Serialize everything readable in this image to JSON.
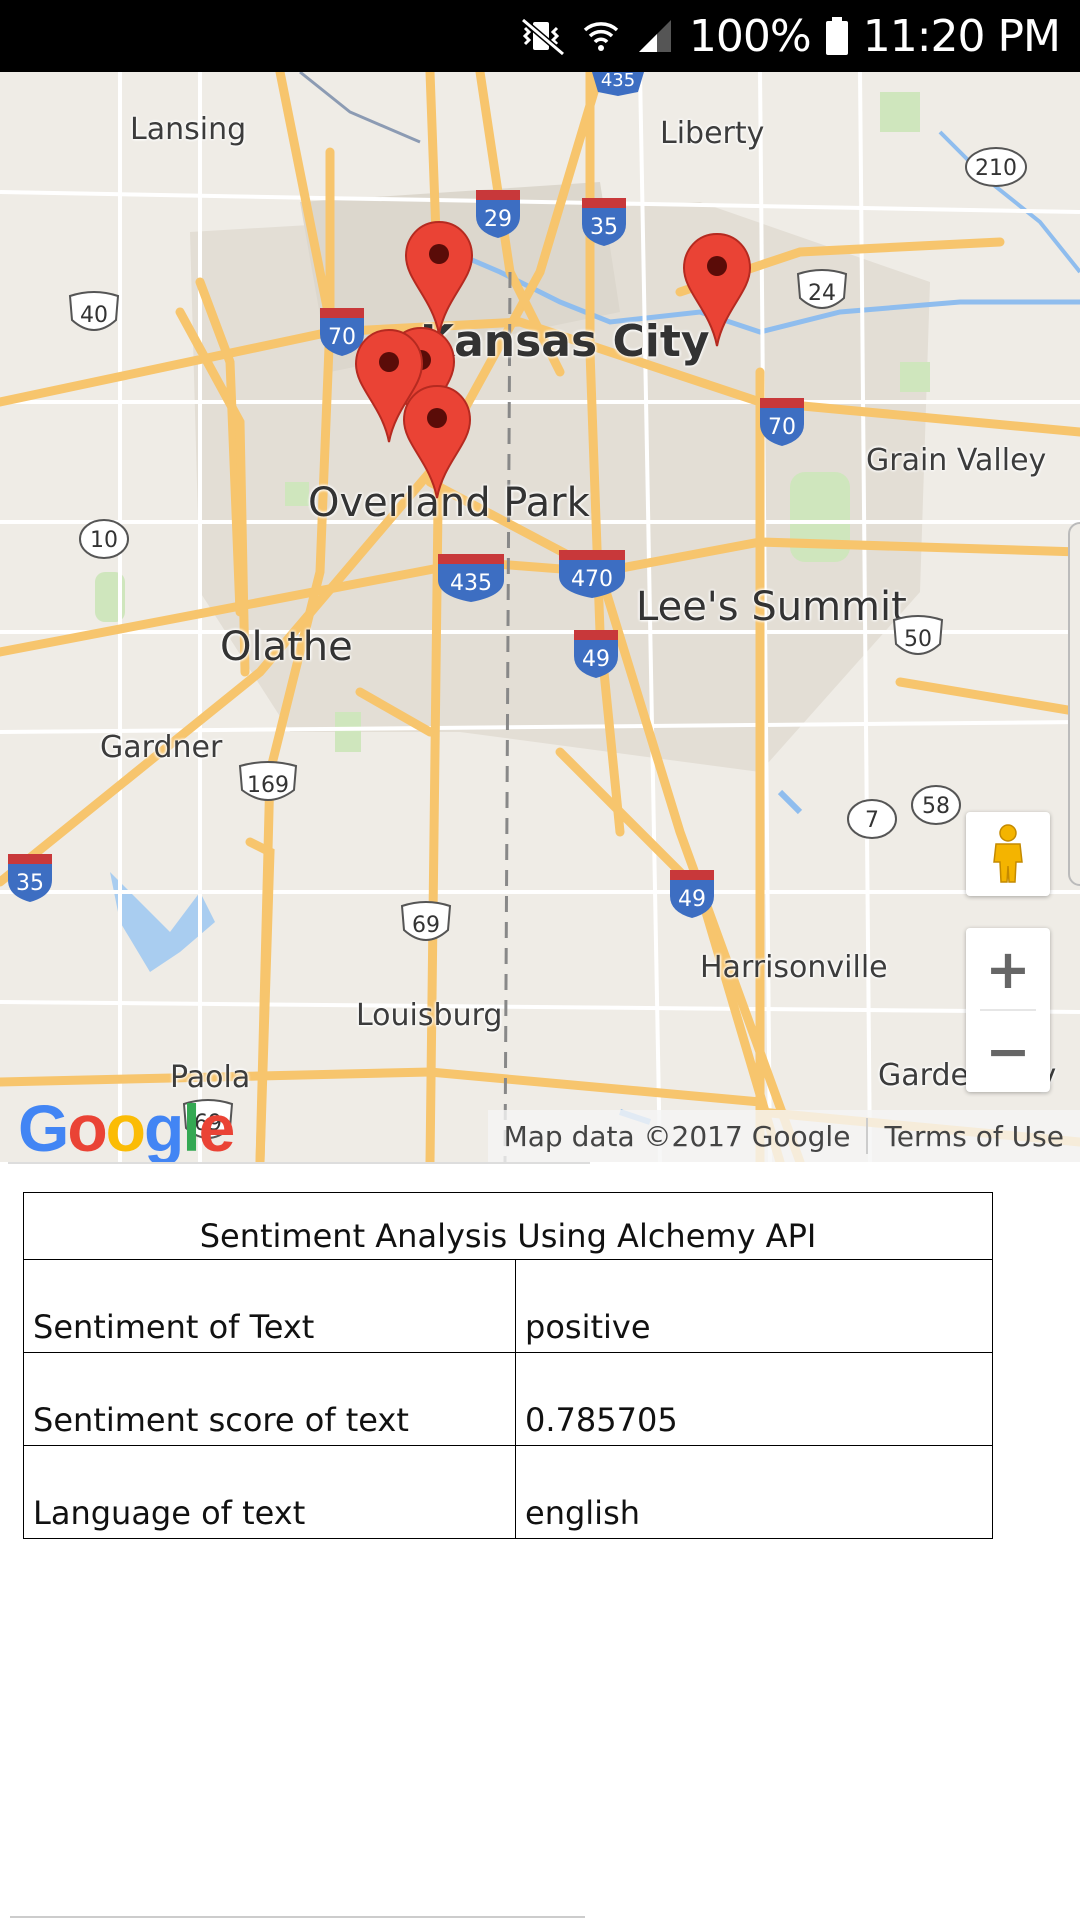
{
  "status_bar": {
    "battery": "100%",
    "time": "11:20 PM",
    "icons": [
      "vibrate-mute-icon",
      "wifi-icon",
      "signal-icon",
      "battery-icon"
    ]
  },
  "map": {
    "places": {
      "lansing": "Lansing",
      "liberty": "Liberty",
      "kansas_city": "Kansas City",
      "grain_valley": "Grain Valley",
      "overland_park": "Overland Park",
      "lees_summit": "Lee's Summit",
      "olathe": "Olathe",
      "gardner": "Gardner",
      "harrisonville": "Harrisonville",
      "louisburg": "Louisburg",
      "paola": "Paola",
      "garden_city": "Garden City"
    },
    "shields": {
      "i435_top": "435",
      "us210": "210",
      "i29": "29",
      "i35_north": "35",
      "us24": "24",
      "us40": "40",
      "i70_west": "70",
      "i70_east": "70",
      "us10": "10",
      "i435_south": "435",
      "i470": "470",
      "us50": "50",
      "i49_north": "49",
      "us169": "169",
      "mo7": "7",
      "mo58": "58",
      "i35_sw": "35",
      "i49_south": "49",
      "us69": "69",
      "us69_paola": "69"
    },
    "markers_count": 5,
    "logo": "Google",
    "attribution": "Map data ©2017 Google",
    "terms": "Terms of Use",
    "zoom_in": "+",
    "zoom_out": "−"
  },
  "sentiment": {
    "title": "Sentiment Analysis Using Alchemy API",
    "rows": [
      {
        "label": "Sentiment of Text",
        "value": "positive"
      },
      {
        "label": "Sentiment score of text",
        "value": "0.785705"
      },
      {
        "label": "Language of text",
        "value": "english"
      }
    ]
  },
  "colors": {
    "map_background": "#efece6",
    "highway": "#f8c46d",
    "marker": "#ea4335",
    "interstate_shield": "#3d6ec2"
  }
}
